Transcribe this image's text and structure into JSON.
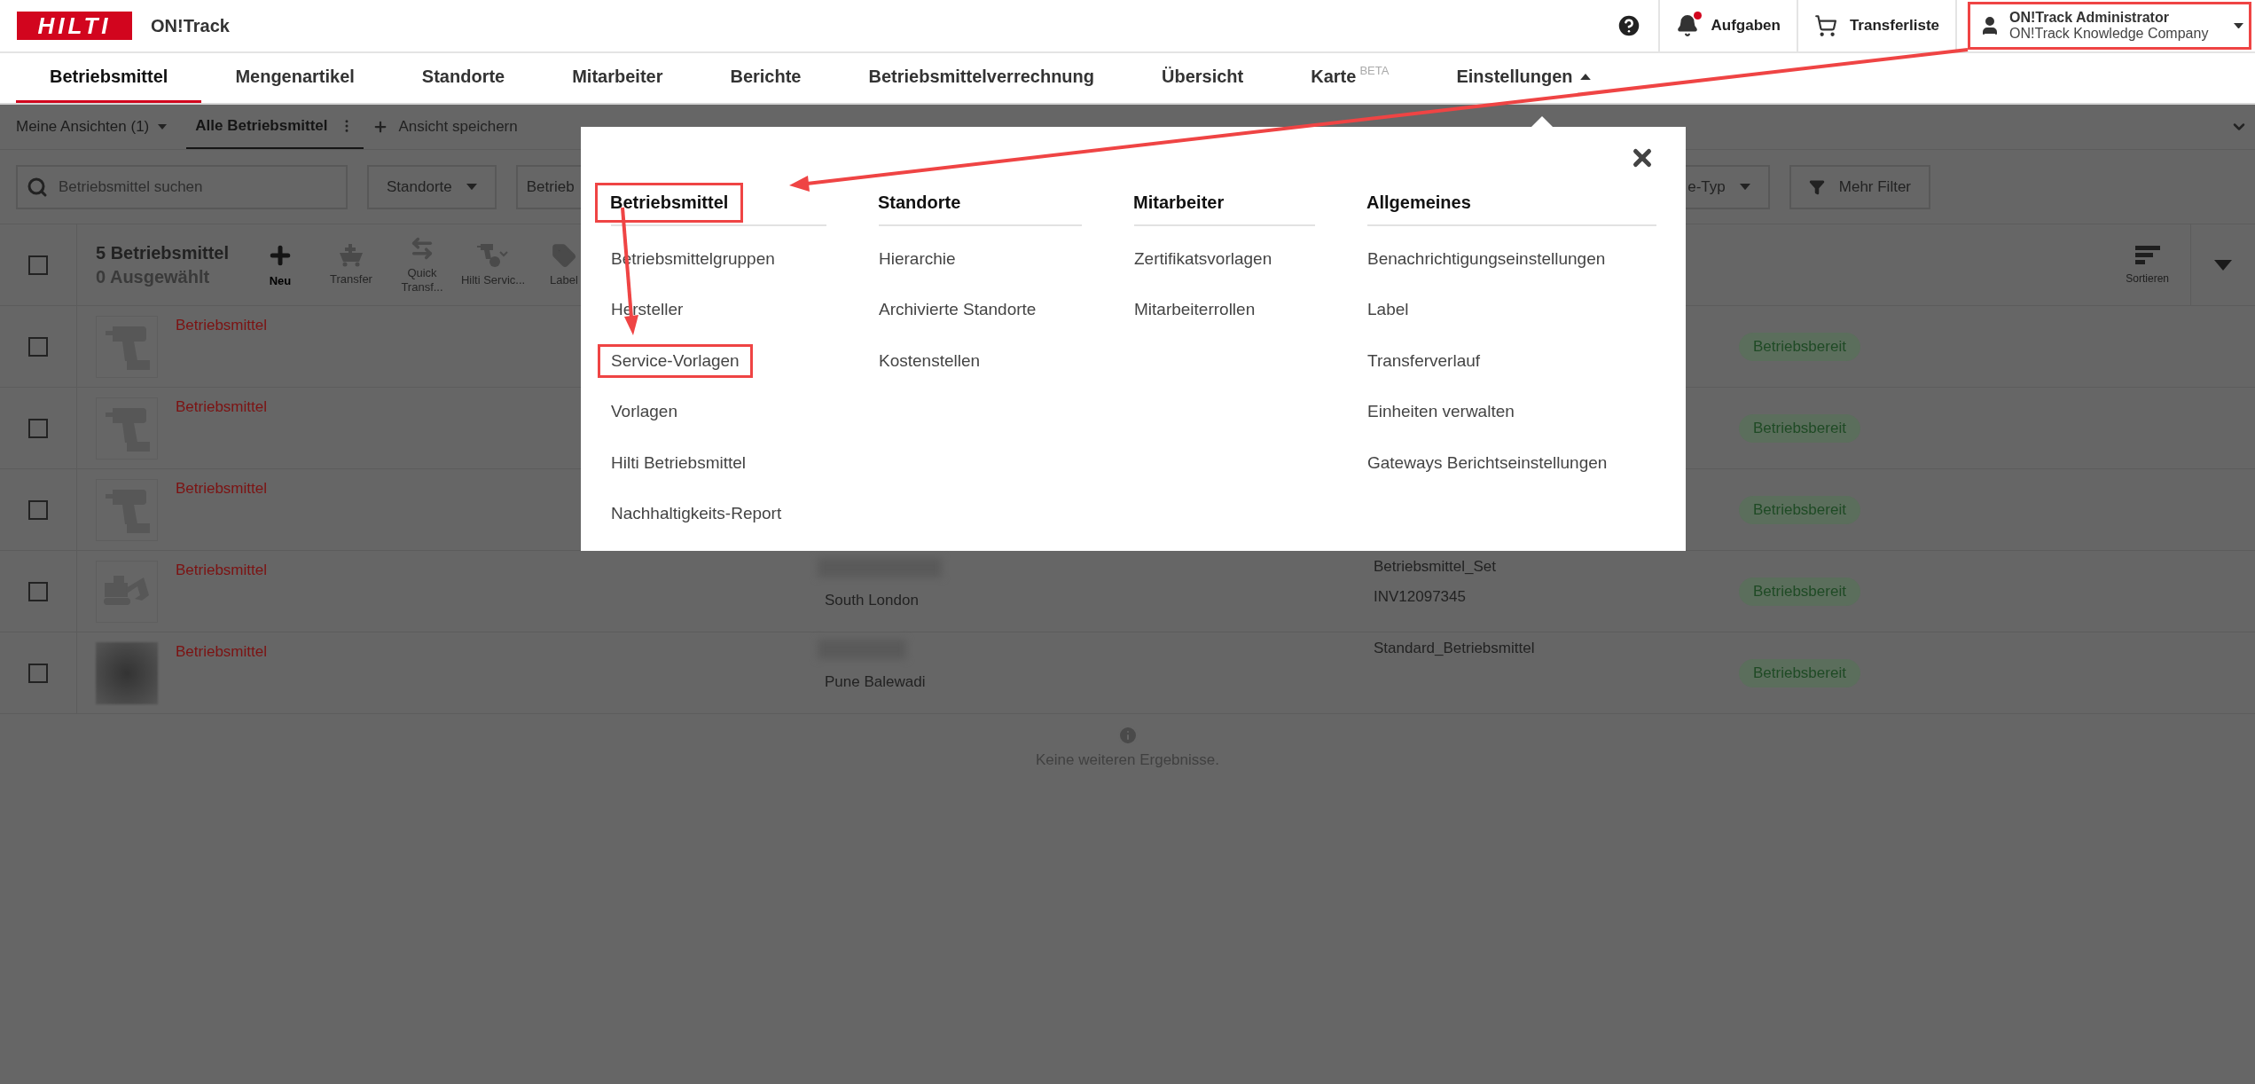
{
  "header": {
    "logo": "HILTI",
    "app_name": "ON!Track",
    "tasks": {
      "label": "Aufgaben",
      "has_notification": true
    },
    "transfer": {
      "label": "Transferliste"
    },
    "user": {
      "name": "ON!Track Administrator",
      "company": "ON!Track Knowledge Company",
      "highlighted": true
    }
  },
  "nav_tabs": [
    {
      "label": "Betriebsmittel",
      "kind": "tab",
      "selected": true
    },
    {
      "label": "Mengenartikel",
      "kind": "tab",
      "selected": false
    },
    {
      "label": "Standorte",
      "kind": "tab",
      "selected": false
    },
    {
      "label": "Mitarbeiter",
      "kind": "tab",
      "selected": false
    },
    {
      "label": "Berichte",
      "kind": "tab",
      "selected": false
    },
    {
      "label": "Betriebsmittelverrechnung",
      "kind": "tab",
      "selected": false
    },
    {
      "label": "Übersicht",
      "kind": "tab",
      "selected": false
    },
    {
      "label": "Karte",
      "badge": "BETA",
      "kind": "tab",
      "selected": false
    },
    {
      "label": "Einstellungen",
      "kind": "menu",
      "selected": false,
      "expanded": true
    }
  ],
  "views_bar": {
    "views_menu": "Meine Ansichten (1)",
    "views": [
      {
        "label": "Alle Betriebsmittel",
        "selected": true
      }
    ],
    "save_view": "Ansicht speichern"
  },
  "filters": {
    "search": {
      "placeholder": "Betriebsmittel suchen"
    },
    "buttons": [
      {
        "label": "Standorte",
        "kind": "dropdown"
      },
      {
        "label": "Betrieb",
        "kind": "cut"
      },
      {
        "label": "e-Typ",
        "kind": "dropdown"
      },
      {
        "label": "Mehr Filter",
        "kind": "filter"
      }
    ]
  },
  "table": {
    "select_all_checked": false,
    "count": "5 Betriebsmittel",
    "selected_count": "0 Ausgewählt",
    "actions": [
      {
        "label": "Neu",
        "kind": "new",
        "disabled": false
      },
      {
        "label": "Transfer",
        "kind": "transfer",
        "disabled": true
      },
      {
        "label": "Quick Transf...",
        "kind": "swap",
        "disabled": true
      },
      {
        "label": "Hilti Servic...",
        "kind": "service",
        "disabled": true
      },
      {
        "label": "Label",
        "kind": "label",
        "disabled": true
      }
    ],
    "sort": "Sortieren",
    "rows": [
      {
        "checked": false,
        "kind": "drill",
        "name": "Betriebsmittel",
        "status": "Betriebsbereit"
      },
      {
        "checked": false,
        "kind": "drill",
        "name": "Betriebsmittel",
        "status": "Betriebsbereit"
      },
      {
        "checked": false,
        "kind": "drill",
        "name": "Betriebsmittel",
        "status": "Betriebsbereit"
      },
      {
        "checked": false,
        "kind": "excavator",
        "name": "Betriebsmittel",
        "location": "South London",
        "details": [
          "Betriebsmittel_Set",
          "INV12097345"
        ],
        "status": "Betriebsbereit"
      },
      {
        "checked": false,
        "kind": "photo",
        "name": "Betriebsmittel",
        "location": "Pune Balewadi",
        "details": [
          "Standard_Betriebsmittel"
        ],
        "status": "Betriebsbereit"
      }
    ],
    "end_message": "Keine weiteren Ergebnisse."
  },
  "settings_menu": {
    "columns": [
      {
        "title": "Betriebsmittel",
        "highlighted": true,
        "items": [
          {
            "label": "Betriebsmittelgruppen",
            "highlighted": false
          },
          {
            "label": "Hersteller",
            "highlighted": false
          },
          {
            "label": "Service-Vorlagen",
            "highlighted": true
          },
          {
            "label": "Vorlagen",
            "highlighted": false
          },
          {
            "label": "Hilti Betriebsmittel",
            "highlighted": false
          },
          {
            "label": "Nachhaltigkeits-Report",
            "highlighted": false
          }
        ]
      },
      {
        "title": "Standorte",
        "highlighted": false,
        "items": [
          {
            "label": "Hierarchie",
            "highlighted": false
          },
          {
            "label": "Archivierte Standorte",
            "highlighted": false
          },
          {
            "label": "Kostenstellen",
            "highlighted": false
          }
        ]
      },
      {
        "title": "Mitarbeiter",
        "highlighted": false,
        "items": [
          {
            "label": "Zertifikatsvorlagen",
            "highlighted": false
          },
          {
            "label": "Mitarbeiterrollen",
            "highlighted": false
          }
        ]
      },
      {
        "title": "Allgemeines",
        "highlighted": false,
        "items": [
          {
            "label": "Benachrichtigungseinstellungen",
            "highlighted": false
          },
          {
            "label": "Label",
            "highlighted": false
          },
          {
            "label": "Transferverlauf",
            "highlighted": false
          },
          {
            "label": "Einheiten verwalten",
            "highlighted": false
          },
          {
            "label": "Gateways Berichtseinstellungen",
            "highlighted": false
          }
        ]
      }
    ]
  }
}
